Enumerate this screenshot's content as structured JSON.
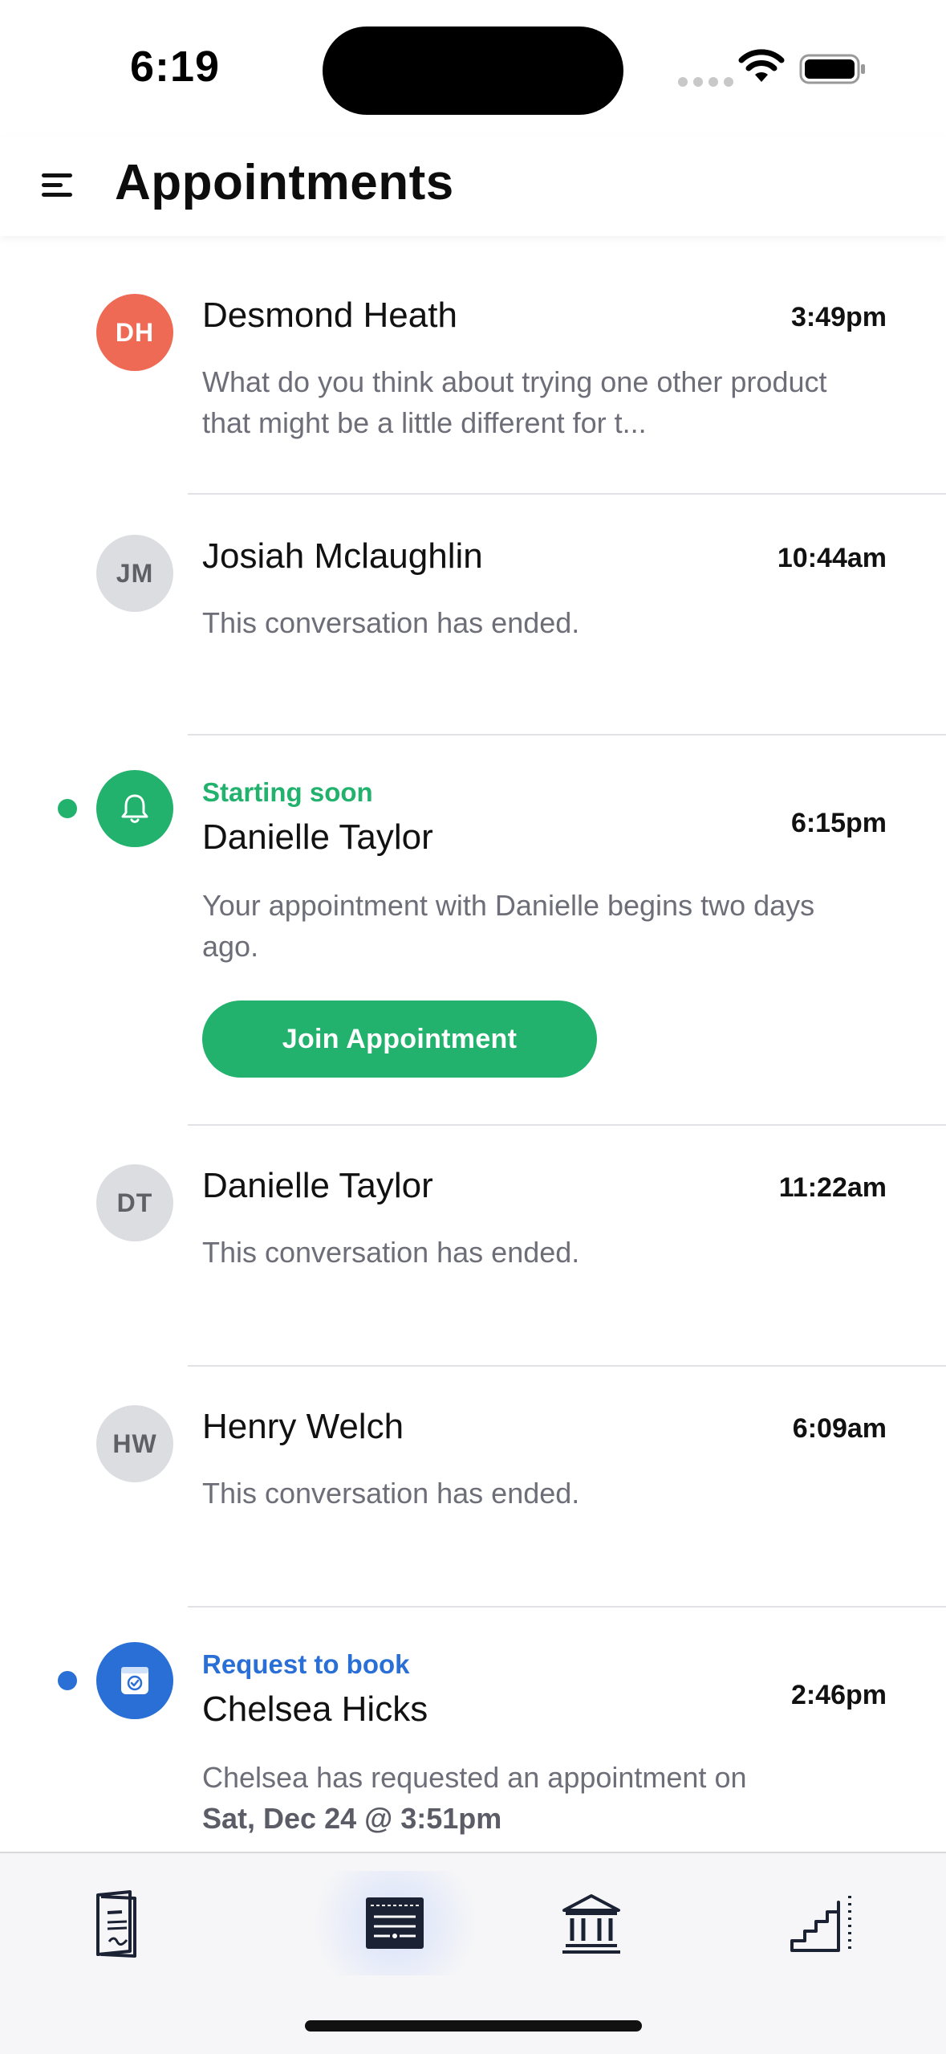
{
  "status_bar": {
    "time": "6:19"
  },
  "header": {
    "title": "Appointments"
  },
  "appointments": [
    {
      "initials": "DH",
      "name": "Desmond Heath",
      "time": "3:49pm",
      "preview": "What do you think about trying one other product that might be a little different for t..."
    },
    {
      "initials": "JM",
      "name": "Josiah Mclaughlin",
      "time": "10:44am",
      "preview": "This conversation has ended."
    },
    {
      "label": "Starting soon",
      "name": "Danielle Taylor",
      "time": "6:15pm",
      "preview": "Your appointment with Danielle begins two days ago.",
      "button": "Join Appointment"
    },
    {
      "initials": "DT",
      "name": "Danielle Taylor",
      "time": "11:22am",
      "preview": "This conversation has ended."
    },
    {
      "initials": "HW",
      "name": "Henry Welch",
      "time": "6:09am",
      "preview": "This conversation has ended."
    },
    {
      "label": "Request to book",
      "name": "Chelsea Hicks",
      "time": "2:46pm",
      "preview": "Chelsea has requested an appointment on",
      "preview_bold": "Sat, Dec 24 @ 3:51pm"
    }
  ],
  "tabbar": {
    "tabs": [
      {
        "icon": "document-icon"
      },
      {
        "icon": "calendar-list-icon",
        "active": true
      },
      {
        "icon": "bank-icon"
      },
      {
        "icon": "stairs-icon"
      }
    ]
  },
  "colors": {
    "green": "#22b26d",
    "blue": "#2a6fd6",
    "coral": "#ef6a55"
  }
}
